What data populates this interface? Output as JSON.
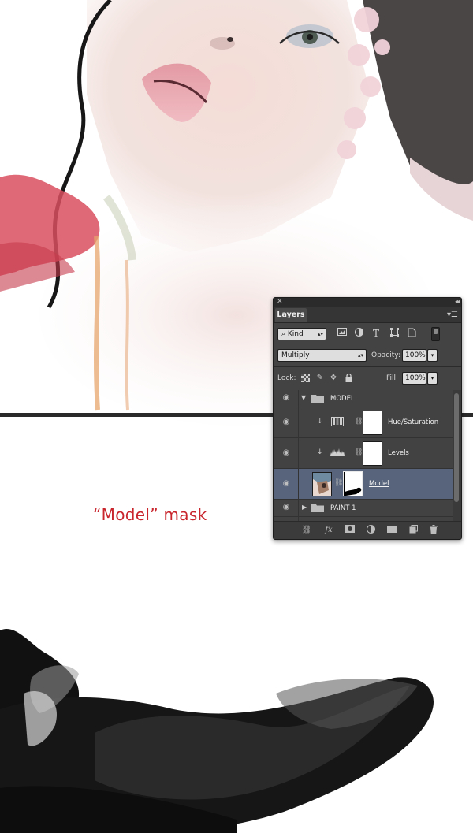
{
  "caption": "“Model” mask",
  "panel": {
    "title": "Layers",
    "close_glyph": "✕",
    "collapse_glyph": "◂◂",
    "menu_glyph": "▾☰",
    "filter": {
      "kind_label": "Kind",
      "icons": [
        "image-filter-icon",
        "adjustment-filter-icon",
        "type-filter-icon",
        "shape-filter-icon",
        "smart-object-filter-icon",
        "filter-toggle-icon"
      ]
    },
    "blend_mode": "Multiply",
    "opacity_label": "Opacity:",
    "opacity_value": "100%",
    "lock_label": "Lock:",
    "fill_label": "Fill:",
    "fill_value": "100%",
    "layers": [
      {
        "name": "MODEL",
        "type": "group",
        "expanded": true
      },
      {
        "name": "Hue/Saturation",
        "type": "adjustment",
        "clipped": true
      },
      {
        "name": "Levels",
        "type": "adjustment",
        "clipped": true
      },
      {
        "name": "Model",
        "type": "image-with-mask",
        "selected": true
      },
      {
        "name": "PAINT 1",
        "type": "group",
        "expanded": false
      }
    ],
    "bottom_icons": [
      "link-layers-icon",
      "fx-icon",
      "add-mask-icon",
      "new-adjustment-icon",
      "new-group-icon",
      "new-layer-icon",
      "trash-icon"
    ]
  },
  "colors": {
    "caption": "#c8252d",
    "panel_bg": "#434343",
    "selected_layer": "#57647b"
  }
}
